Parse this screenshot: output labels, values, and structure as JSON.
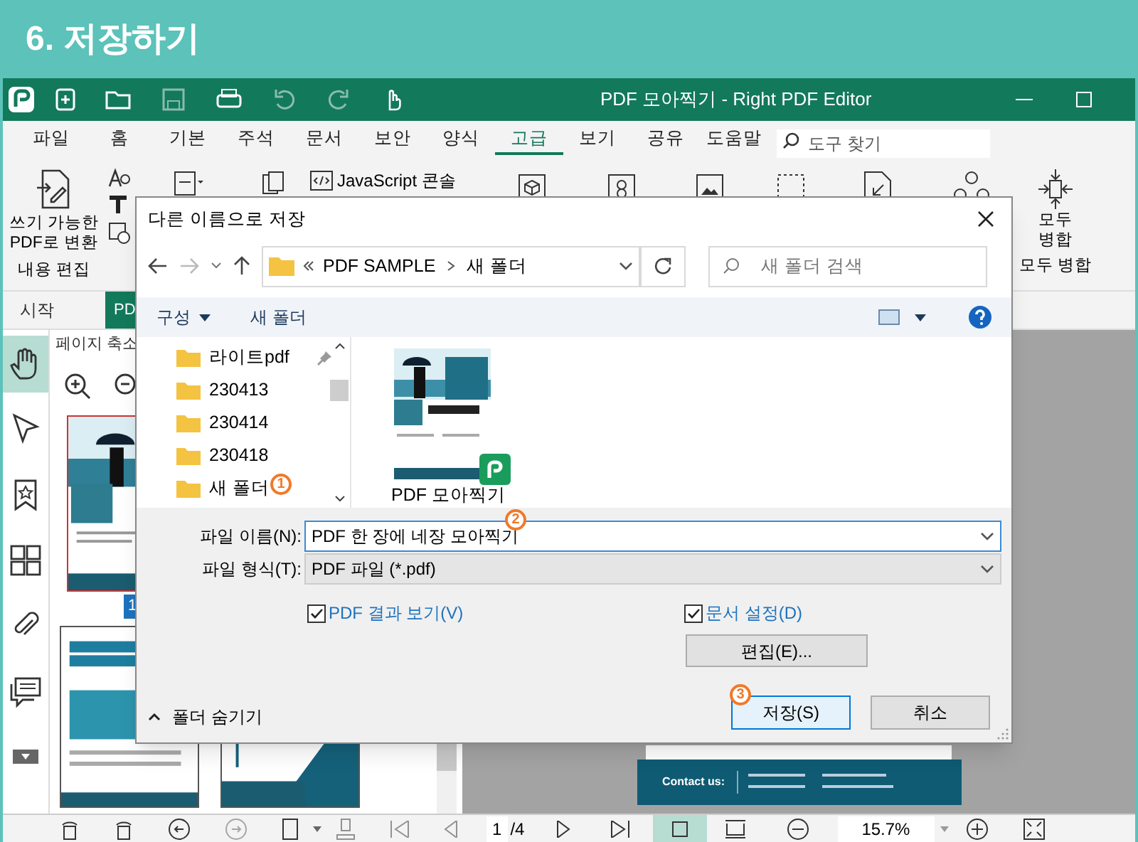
{
  "banner": {
    "title": "6. 저장하기"
  },
  "window": {
    "title": "PDF 모아찍기 - Right PDF Editor"
  },
  "menu": [
    {
      "label": "파일",
      "selected": false
    },
    {
      "label": "홈",
      "selected": false
    },
    {
      "label": "기본",
      "selected": false
    },
    {
      "label": "주석",
      "selected": false
    },
    {
      "label": "문서",
      "selected": false
    },
    {
      "label": "보안",
      "selected": false
    },
    {
      "label": "양식",
      "selected": false
    },
    {
      "label": "고급",
      "selected": true
    },
    {
      "label": "보기",
      "selected": false
    },
    {
      "label": "공유",
      "selected": false
    },
    {
      "label": "도움말",
      "selected": false
    }
  ],
  "tool_search": {
    "placeholder": "도구 찾기"
  },
  "ribbon": {
    "convert_button": "쓰기 가능한 PDF로 변환",
    "edit_group": "내용 편집",
    "js_console": "JavaScript 콘솔",
    "merge_button": "모두 병합",
    "merge_group": "모두 병합"
  },
  "doc_tabs": [
    {
      "label": "시작",
      "selected": false
    },
    {
      "label": "PD",
      "selected": true
    }
  ],
  "side_tools": [
    {
      "kind": "hand",
      "selected": true
    },
    {
      "kind": "pointer",
      "selected": false
    },
    {
      "kind": "bookmark",
      "selected": false
    },
    {
      "kind": "grid",
      "selected": false
    },
    {
      "kind": "clip",
      "selected": false
    },
    {
      "kind": "comment",
      "selected": false
    },
    {
      "kind": "more",
      "selected": false
    }
  ],
  "thumbnail_panel": {
    "title": "페이지 축소",
    "page_badge": "1"
  },
  "document": {
    "contact_label": "Contact us:"
  },
  "status_bar": {
    "page": "1",
    "page_count": "/4",
    "zoom": "15.7%"
  },
  "dialog": {
    "title": "다른 이름으로 저장",
    "path": [
      "PDF SAMPLE",
      "새 폴더"
    ],
    "search_placeholder": "새 폴더 검색",
    "organize": "구성",
    "new_folder": "새 폴더",
    "folders": [
      {
        "name": "라이트pdf",
        "pinned": true
      },
      {
        "name": "230413",
        "pinned": false
      },
      {
        "name": "230414",
        "pinned": false
      },
      {
        "name": "230418",
        "pinned": false
      },
      {
        "name": "새 폴더",
        "pinned": false
      }
    ],
    "files": [
      {
        "name": "PDF 모아찍기"
      }
    ],
    "file_name_label": "파일 이름(N):",
    "file_name": "PDF 한 장에 네장 모아찍기",
    "file_type_label": "파일 형식(T):",
    "file_type": "PDF 파일 (*.pdf)",
    "options": [
      {
        "label": "PDF 결과 보기(V)",
        "checked": true
      },
      {
        "label": "문서 설정(D)",
        "checked": true
      }
    ],
    "edit_button": "편집(E)...",
    "hide_folders": "폴더 숨기기",
    "buttons": [
      {
        "label": "저장(S)",
        "kind": "primary"
      },
      {
        "label": "취소",
        "kind": "secondary"
      }
    ]
  },
  "annotations": [
    {
      "label": "1"
    },
    {
      "label": "2"
    },
    {
      "label": "3"
    }
  ]
}
